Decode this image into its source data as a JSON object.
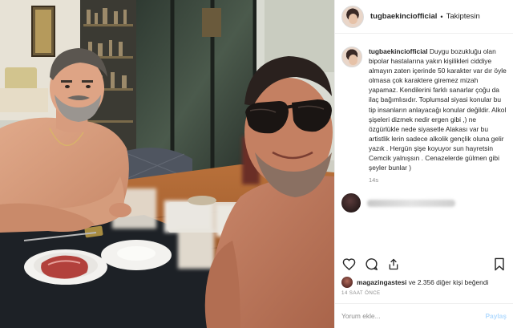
{
  "post": {
    "username": "tugbaekinciofficial",
    "header_dot": "•",
    "follow_status": "Takiptesin",
    "caption_user": "tugbaekinciofficial",
    "caption_text": "Duygu bozukluğu olan bipolar hastalarına yakın kişilikleri ciddiye almayın zaten içerinde 50 karakter var dır öyle olmasa çok karaktere giremez mizah yapamaz. Kendilerini farklı sanarlar çoğu da ilaç bağımlısıdır. Toplumsal siyasi konular bu tip insanların anlayacağı konular değildir. Alkol şişeleri dizmek nedir ergen gibi ,) ne özgürlükle nede siyasetle Alakası var bu artistlik lerin sadece alkolik gençlik oluna gelir yazık . Hergün şişe koyuyor sun hayretsin Cemcik yalnışsın . Cenazelerde gülmen gibi şeyler bunlar )",
    "caption_time": "14s",
    "likes_user": "magazingastesi",
    "likes_rest": " ve 2.356 diğer kişi beğendi",
    "post_time": "14 SAAT ÖNCE",
    "comment_placeholder": "Yorum ekle...",
    "post_button": "Paylaş"
  },
  "icons": {
    "like": "heart-icon",
    "comment": "comment-icon",
    "share": "share-icon",
    "save": "bookmark-icon"
  },
  "colors": {
    "text": "#262626",
    "muted": "#8e8e8e",
    "border": "#efefef",
    "post_button_disabled": "#b3dbff"
  }
}
